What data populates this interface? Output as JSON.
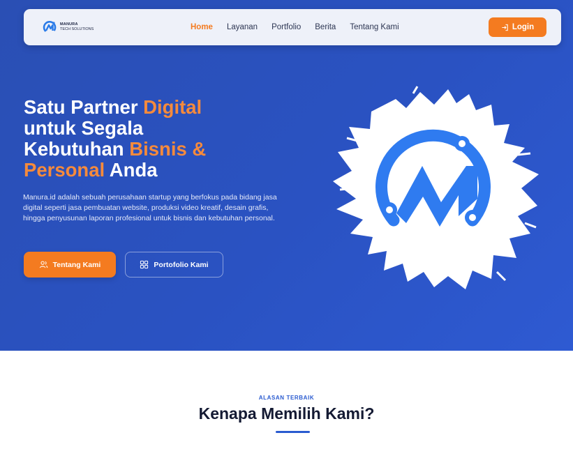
{
  "nav": {
    "brand_name": "MANURA",
    "brand_sub": "TECH SOLUTIONS",
    "links": [
      "Home",
      "Layanan",
      "Portfolio",
      "Berita",
      "Tentang Kami"
    ],
    "active": "Home",
    "login_label": "Login"
  },
  "hero": {
    "title_parts": {
      "p1": "Satu Partner ",
      "p2": "Digital",
      "p3": "untuk Segala",
      "p4": "Kebutuhan ",
      "p5": "Bisnis &",
      "p6": "Personal",
      "p7": " Anda"
    },
    "description": "Manura.id adalah sebuah perusahaan startup yang berfokus pada bidang jasa digital seperti jasa pembuatan website, produksi video kreatif, desain grafis, hingga penyusunan laporan profesional untuk bisnis dan kebutuhan personal.",
    "primary_button": "Tentang Kami",
    "secondary_button": "Portofolio Kami"
  },
  "why": {
    "eyebrow": "ALASAN TERBAIK",
    "title": "Kenapa Memilih Kami?"
  },
  "icons": {
    "login": "login-icon",
    "users": "users-icon",
    "grid": "grid-icon",
    "logo": "manura-logo-icon"
  },
  "colors": {
    "accent": "#f47b20",
    "brand_blue": "#2a5bd0",
    "hero_bg": "#2a4fb4",
    "title_dark": "#141a33"
  }
}
